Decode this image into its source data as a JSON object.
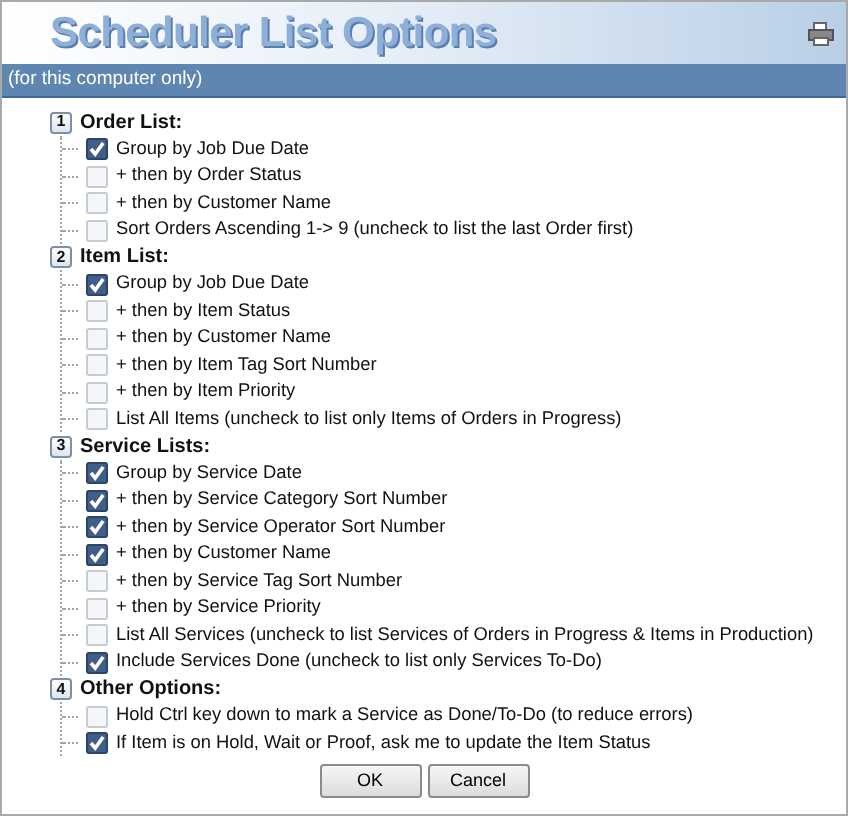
{
  "title": "Scheduler List Options",
  "subtitle": "(for this computer only)",
  "sections": [
    {
      "number": "1",
      "label": "Order List:",
      "options": [
        {
          "label": "Group by Job Due Date",
          "checked": true
        },
        {
          "label": "+ then by Order Status",
          "checked": false
        },
        {
          "label": "+ then by Customer Name",
          "checked": false
        },
        {
          "label": "Sort Orders Ascending 1-> 9 (uncheck to list the last Order first)",
          "checked": false
        }
      ]
    },
    {
      "number": "2",
      "label": "Item List:",
      "options": [
        {
          "label": "Group by Job Due Date",
          "checked": true
        },
        {
          "label": "+ then by Item Status",
          "checked": false
        },
        {
          "label": "+ then by Customer Name",
          "checked": false
        },
        {
          "label": "+ then by Item Tag Sort Number",
          "checked": false
        },
        {
          "label": "+ then by Item Priority",
          "checked": false
        },
        {
          "label": "List All Items (uncheck to list only Items of Orders in Progress)",
          "checked": false
        }
      ]
    },
    {
      "number": "3",
      "label": "Service Lists:",
      "options": [
        {
          "label": "Group by Service Date",
          "checked": true
        },
        {
          "label": "+ then by Service Category Sort Number",
          "checked": true
        },
        {
          "label": "+ then by Service Operator Sort Number",
          "checked": true
        },
        {
          "label": "+ then by Customer Name",
          "checked": true
        },
        {
          "label": "+ then by Service Tag Sort Number",
          "checked": false
        },
        {
          "label": "+ then by Service Priority",
          "checked": false
        },
        {
          "label": "List All Services (uncheck to list Services of Orders in Progress & Items in Production)",
          "checked": false
        },
        {
          "label": "Include Services Done (uncheck to list only Services To-Do)",
          "checked": true
        }
      ]
    },
    {
      "number": "4",
      "label": "Other Options:",
      "options": [
        {
          "label": "Hold Ctrl key down to mark a Service as Done/To-Do (to reduce errors)",
          "checked": false
        },
        {
          "label": "If Item is on Hold, Wait or Proof, ask me to update the Item Status",
          "checked": true
        }
      ]
    }
  ],
  "buttons": [
    "OK",
    "Cancel"
  ]
}
